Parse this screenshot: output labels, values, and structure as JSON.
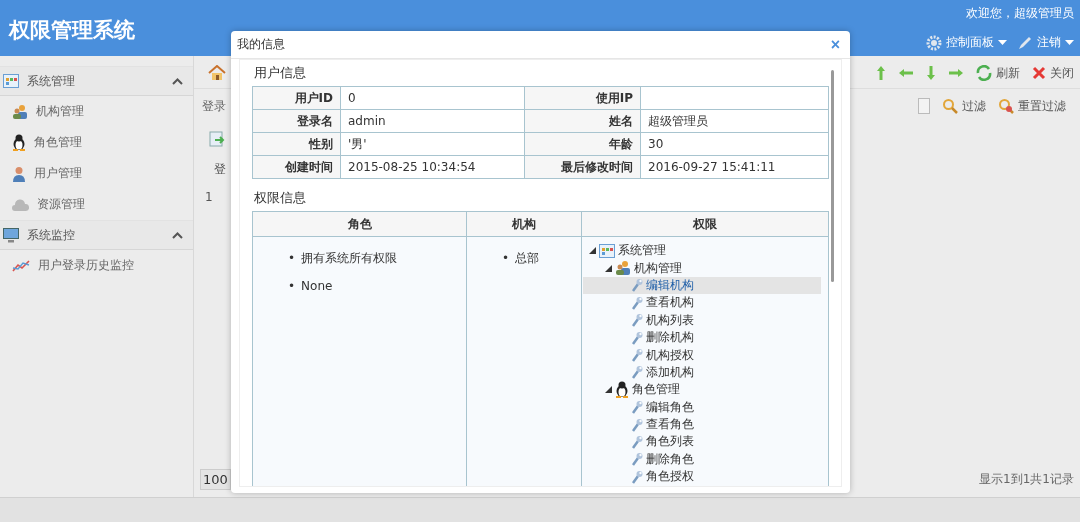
{
  "header": {
    "title": "权限管理系统",
    "welcome": "欢迎您，超级管理员",
    "menus": [
      {
        "label": "控制面板",
        "kind": "gear"
      },
      {
        "label": "注销",
        "kind": "pen"
      }
    ]
  },
  "sidebar": {
    "panels": [
      {
        "title": "系统管理",
        "kind": "grid",
        "expanded": true,
        "items": [
          {
            "label": "机构管理",
            "kind": "people"
          },
          {
            "label": "角色管理",
            "kind": "penguin"
          },
          {
            "label": "用户管理",
            "kind": "user"
          },
          {
            "label": "资源管理",
            "kind": "cloud"
          }
        ]
      },
      {
        "title": "系统监控",
        "kind": "monitor",
        "expanded": true,
        "items": [
          {
            "label": "用户登录历史监控",
            "kind": "chart"
          }
        ]
      }
    ]
  },
  "main": {
    "toolbar": [
      {
        "kind": "up"
      },
      {
        "kind": "left"
      },
      {
        "kind": "down"
      },
      {
        "kind": "right"
      },
      {
        "kind": "refresh",
        "label": "刷新"
      },
      {
        "kind": "close",
        "label": "关闭"
      }
    ],
    "filter_label": "登录",
    "filter_buttons": [
      {
        "kind": "search",
        "label": "过滤"
      },
      {
        "kind": "reset",
        "label": "重置过滤"
      }
    ],
    "column_1": "登",
    "row_number": "1",
    "page_size": "100",
    "status": "显示1到1共1记录"
  },
  "dialog": {
    "title": "我的信息",
    "close": "×",
    "user_section": "用户信息",
    "user_info": [
      [
        {
          "label": "用户ID",
          "value": "0"
        },
        {
          "label": "使用IP"
        }
      ],
      [
        {
          "label": "登录名",
          "value": "admin"
        },
        {
          "label": "姓名",
          "value": "超级管理员"
        }
      ],
      [
        {
          "label": "性别",
          "value": "'男'"
        },
        {
          "label": "年龄",
          "value": "30"
        }
      ],
      [
        {
          "label": "创建时间",
          "value": "2015-08-25 10:34:54"
        },
        {
          "label": "最后修改时间",
          "value": "2016-09-27 15:41:11"
        }
      ]
    ],
    "perm_section": "权限信息",
    "columns": [
      "角色",
      "机构",
      "权限"
    ],
    "roles": [
      {
        "marker": "•",
        "text": "拥有系统所有权限"
      },
      {
        "marker": "•",
        "text": "None"
      }
    ],
    "orgs": [
      {
        "marker": "•",
        "text": "总部"
      }
    ],
    "tree": [
      {
        "label": "系统管理",
        "kind": "grid",
        "expanded": true,
        "selected": false,
        "children": [
          {
            "label": "机构管理",
            "kind": "people",
            "expanded": true,
            "selected": false,
            "children": [
              {
                "label": "编辑机构",
                "kind": "wrench",
                "selected": true
              },
              {
                "label": "查看机构",
                "kind": "wrench",
                "selected": false
              },
              {
                "label": "机构列表",
                "kind": "wrench",
                "selected": false
              },
              {
                "label": "删除机构",
                "kind": "wrench",
                "selected": false
              },
              {
                "label": "机构授权",
                "kind": "wrench",
                "selected": false
              },
              {
                "label": "添加机构",
                "kind": "wrench",
                "selected": false
              }
            ]
          },
          {
            "label": "角色管理",
            "kind": "penguin",
            "expanded": true,
            "selected": false,
            "children": [
              {
                "label": "编辑角色",
                "kind": "wrench",
                "selected": false
              },
              {
                "label": "查看角色",
                "kind": "wrench",
                "selected": false
              },
              {
                "label": "角色列表",
                "kind": "wrench",
                "selected": false
              },
              {
                "label": "删除角色",
                "kind": "wrench",
                "selected": false
              },
              {
                "label": "角色授权",
                "kind": "wrench",
                "selected": false
              }
            ]
          }
        ]
      }
    ]
  }
}
